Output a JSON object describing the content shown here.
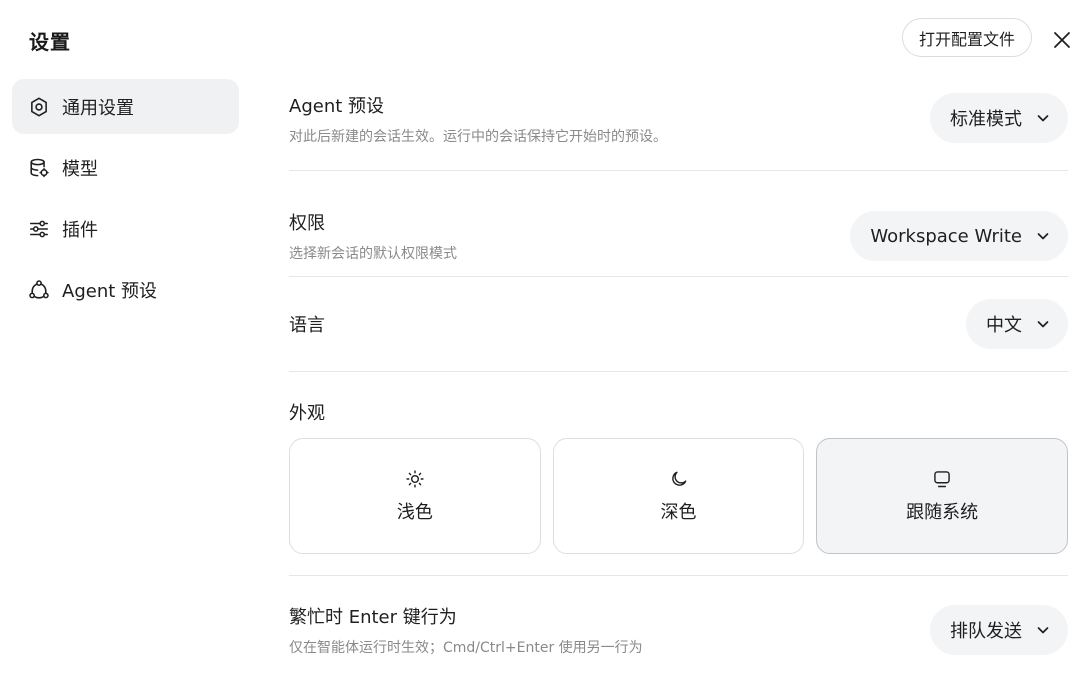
{
  "header": {
    "title": "设置",
    "open_config_label": "打开配置文件"
  },
  "sidebar": {
    "items": [
      {
        "label": "通用设置",
        "icon": "gear-icon",
        "active": true
      },
      {
        "label": "模型",
        "icon": "database-icon",
        "active": false
      },
      {
        "label": "插件",
        "icon": "sliders-icon",
        "active": false
      },
      {
        "label": "Agent 预设",
        "icon": "agent-network-icon",
        "active": false
      }
    ]
  },
  "settings": {
    "agent_preset": {
      "title": "Agent 预设",
      "description": "对此后新建的会话生效。运行中的会话保持它开始时的预设。",
      "value": "标准模式"
    },
    "permissions": {
      "title": "权限",
      "description": "选择新会话的默认权限模式",
      "value": "Workspace Write"
    },
    "language": {
      "title": "语言",
      "value": "中文"
    },
    "appearance": {
      "title": "外观",
      "options": [
        {
          "label": "浅色",
          "icon": "sun-icon",
          "selected": false
        },
        {
          "label": "深色",
          "icon": "moon-icon",
          "selected": false
        },
        {
          "label": "跟随系统",
          "icon": "monitor-icon",
          "selected": true
        }
      ]
    },
    "busy_enter": {
      "title": "繁忙时 Enter 键行为",
      "description": "仅在智能体运行时生效；Cmd/Ctrl+Enter 使用另一行为",
      "value": "排队发送"
    }
  },
  "colors": {
    "active_bg": "#f0f1f3",
    "select_bg": "#f3f4f5",
    "muted_text": "#8a8a8a",
    "divider": "#e7e7e7"
  }
}
